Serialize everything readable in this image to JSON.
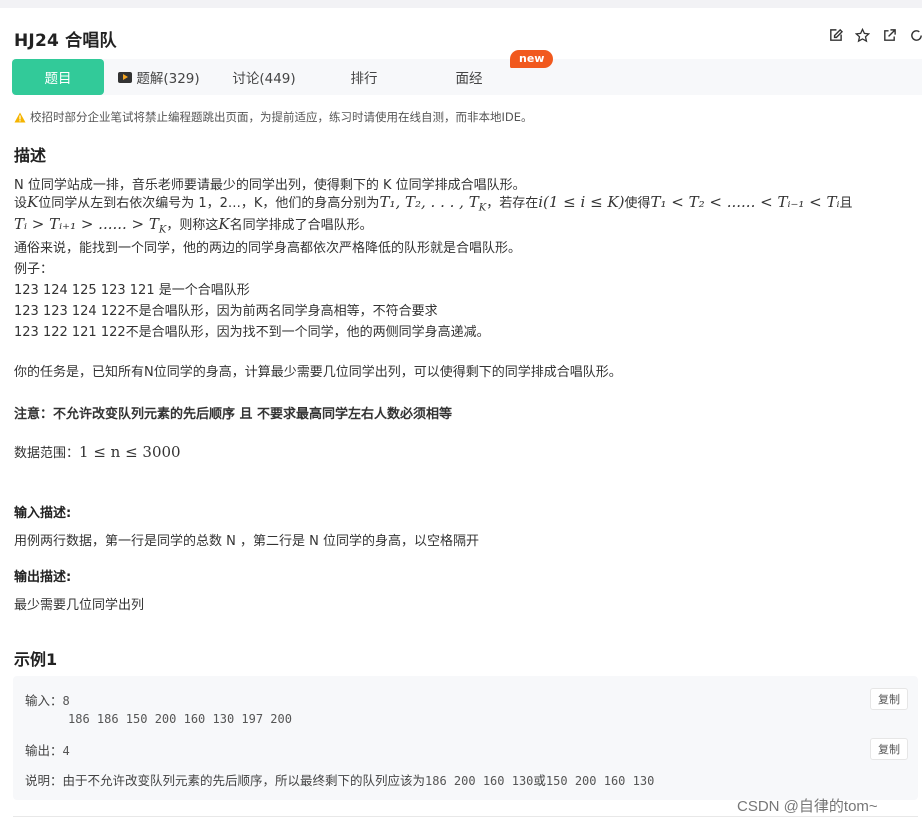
{
  "header": {
    "title": "HJ24  合唱队"
  },
  "tabs": [
    {
      "label": "题目"
    },
    {
      "label": "题解(329)"
    },
    {
      "label": "讨论(449)"
    },
    {
      "label": "排行"
    },
    {
      "label": "面经"
    }
  ],
  "badge": {
    "new": "new"
  },
  "notice": "校招时部分企业笔试将禁止编程题跳出页面，为提前适应，练习时请使用在线自测，而非本地IDE。",
  "description": {
    "heading": "描述",
    "line1": "N 位同学站成一排，音乐老师要请最少的同学出列，使得剩下的 K 位同学排成合唱队形。",
    "line2_a": "设",
    "line2_k": "K",
    "line2_b": "位同学从左到右依次编号为 1，2…，K，他们的身高分别为",
    "line2_t": "T₁, T₂, . . . , T",
    "line2_tk": "K",
    "line2_c": "，若存在",
    "line2_cond": "i(1 ≤ i ≤ K)",
    "line2_d": "使得",
    "line2_ineq": "T₁ < T₂ < ...... < Tᵢ₋₁ < Tᵢ",
    "line2_e": "且",
    "line3_ineq": "Tᵢ > Tᵢ₊₁ > ...... > T",
    "line3_tk": "K",
    "line3_a": "，则称这",
    "line3_k": "K",
    "line3_b": "名同学排成了合唱队形。",
    "line4": "通俗来说，能找到一个同学，他的两边的同学身高都依次严格降低的队形就是合唱队形。",
    "line5": "例子：",
    "line6": "123 124 125 123 121 是一个合唱队形",
    "line7": "123 123 124 122不是合唱队形，因为前两名同学身高相等，不符合要求",
    "line8": "123 122 121 122不是合唱队形，因为找不到一个同学，他的两侧同学身高递减。",
    "line9": "你的任务是，已知所有N位同学的身高，计算最少需要几位同学出列，可以使得剩下的同学排成合唱队形。",
    "note": "注意：不允许改变队列元素的先后顺序 且 不要求最高同学左右人数必须相等",
    "range_label": "数据范围：",
    "range_math": "1 ≤ n ≤ 3000"
  },
  "input_desc": {
    "heading": "输入描述:",
    "text": "用例两行数据，第一行是同学的总数 N ，第二行是 N 位同学的身高，以空格隔开"
  },
  "output_desc": {
    "heading": "输出描述:",
    "text": "最少需要几位同学出列"
  },
  "example": {
    "heading": "示例1",
    "input_label": "输入：",
    "input_line1": "8",
    "input_line2": "186 186 150 200 160 130 197 200",
    "output_label": "输出：",
    "output_value": "4",
    "explain_label": "说明：",
    "explain_a": "由于不允许改变队列元素的先后顺序，所以最终剩下的队列应该为",
    "explain_seq1": "186 200 160 130",
    "explain_b": "或",
    "explain_seq2": "150 200 160 130",
    "copy_label": "复制"
  },
  "watermark": "CSDN @自律的tom~",
  "colors": {
    "accent": "#32ca99",
    "badge": "#f1591e",
    "warning": "#f5b400"
  }
}
